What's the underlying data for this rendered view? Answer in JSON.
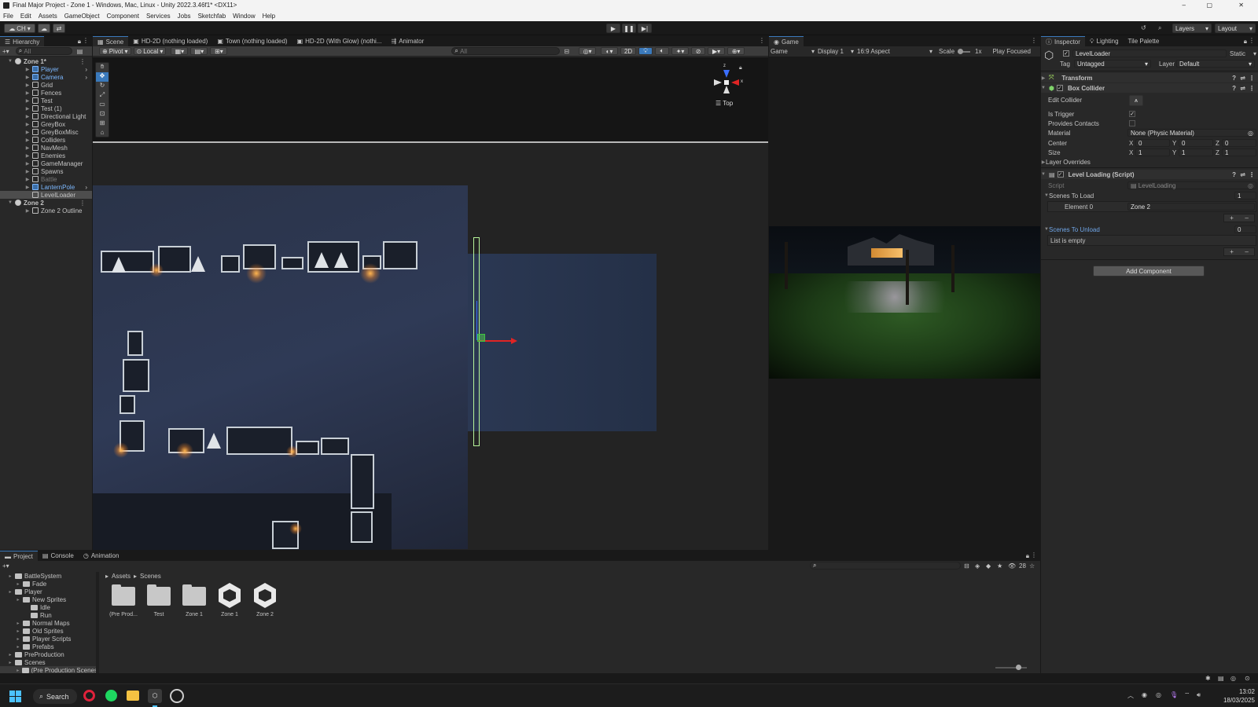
{
  "window": {
    "title": "Final Major Project - Zone 1 - Windows, Mac, Linux - Unity 2022.3.46f1* <DX11>",
    "min": "–",
    "max": "▢",
    "close": "✕"
  },
  "menu": [
    "File",
    "Edit",
    "Assets",
    "GameObject",
    "Component",
    "Services",
    "Jobs",
    "Sketchfab",
    "Window",
    "Help"
  ],
  "toolbar": {
    "account": "CH",
    "layers": "Layers",
    "layout": "Layout"
  },
  "hierarchy": {
    "tab": "Hierarchy",
    "search_placeholder": "All",
    "items": [
      {
        "label": "Zone 1*",
        "depth": 0,
        "type": "scene",
        "expanded": true
      },
      {
        "label": "Player",
        "depth": 1,
        "type": "prefab"
      },
      {
        "label": "Camera",
        "depth": 1,
        "type": "prefab"
      },
      {
        "label": "Grid",
        "depth": 1,
        "type": "obj"
      },
      {
        "label": "Fences",
        "depth": 1,
        "type": "obj"
      },
      {
        "label": "Test",
        "depth": 1,
        "type": "obj"
      },
      {
        "label": "Test (1)",
        "depth": 1,
        "type": "obj"
      },
      {
        "label": "Directional Light",
        "depth": 1,
        "type": "obj"
      },
      {
        "label": "GreyBox",
        "depth": 1,
        "type": "obj"
      },
      {
        "label": "GreyBoxMisc",
        "depth": 1,
        "type": "obj"
      },
      {
        "label": "Colliders",
        "depth": 1,
        "type": "obj"
      },
      {
        "label": "NavMesh",
        "depth": 1,
        "type": "obj"
      },
      {
        "label": "Enemies",
        "depth": 1,
        "type": "obj"
      },
      {
        "label": "GameManager",
        "depth": 1,
        "type": "obj"
      },
      {
        "label": "Spawns",
        "depth": 1,
        "type": "obj"
      },
      {
        "label": "Battle",
        "depth": 1,
        "type": "disabled"
      },
      {
        "label": "LanternPole",
        "depth": 1,
        "type": "prefab"
      },
      {
        "label": "LevelLoader",
        "depth": 1,
        "type": "selected"
      },
      {
        "label": "Zone 2",
        "depth": 0,
        "type": "scene",
        "expanded": true
      },
      {
        "label": "Zone 2 Outline",
        "depth": 1,
        "type": "obj"
      }
    ]
  },
  "scene_tabs": [
    {
      "label": "Scene",
      "active": true
    },
    {
      "label": "HD-2D (nothing loaded)"
    },
    {
      "label": "Town (nothing loaded)"
    },
    {
      "label": "HD-2D (With Glow) (nothi..."
    },
    {
      "label": "Animator"
    }
  ],
  "scene_toolbar": {
    "pivot": "Pivot",
    "local": "Local",
    "search_placeholder": "All",
    "mode_2d": "2D",
    "gizmo_view": "Top"
  },
  "game": {
    "tab": "Game",
    "display_mode": "Game",
    "display": "Display 1",
    "aspect": "16:9 Aspect",
    "scale_label": "Scale",
    "scale_value": "1x",
    "play_mode": "Play Focused"
  },
  "inspector": {
    "tabs": [
      "Inspector",
      "Lighting",
      "Tile Palette"
    ],
    "object_name": "LevelLoader",
    "static_label": "Static",
    "tag_label": "Tag",
    "tag_value": "Untagged",
    "layer_label": "Layer",
    "layer_value": "Default",
    "transform": "Transform",
    "box_collider": "Box Collider",
    "edit_collider": "Edit Collider",
    "is_trigger": "Is Trigger",
    "provides_contacts": "Provides Contacts",
    "material_label": "Material",
    "material_value": "None (Physic Material)",
    "center_label": "Center",
    "center": {
      "x": "0",
      "y": "0",
      "z": "0"
    },
    "size_label": "Size",
    "size": {
      "x": "1",
      "y": "1",
      "z": "1"
    },
    "layer_overrides": "Layer Overrides",
    "script_component": "Level Loading (Script)",
    "script_label": "Script",
    "script_value": "LevelLoading",
    "scenes_to_load": "Scenes To Load",
    "scenes_to_load_count": "1",
    "element0_label": "Element 0",
    "element0_value": "Zone 2",
    "scenes_to_unload": "Scenes To Unload",
    "scenes_to_unload_count": "0",
    "list_empty": "List is empty",
    "add_component": "Add Component",
    "axis_x": "X",
    "axis_y": "Y",
    "axis_z": "Z",
    "plus": "+",
    "minus": "–"
  },
  "project": {
    "tabs": [
      "Project",
      "Console",
      "Animation"
    ],
    "tree": [
      {
        "label": "BattleSystem",
        "depth": 0
      },
      {
        "label": "Fade",
        "depth": 1
      },
      {
        "label": "Player",
        "depth": 0
      },
      {
        "label": "New Sprites",
        "depth": 1
      },
      {
        "label": "Idle",
        "depth": 2
      },
      {
        "label": "Run",
        "depth": 2
      },
      {
        "label": "Normal Maps",
        "depth": 1
      },
      {
        "label": "Old Sprites",
        "depth": 1
      },
      {
        "label": "Player Scripts",
        "depth": 1
      },
      {
        "label": "Prefabs",
        "depth": 1
      },
      {
        "label": "PreProduction",
        "depth": 0
      },
      {
        "label": "Scenes",
        "depth": 0
      },
      {
        "label": "(Pre Production Scenes",
        "depth": 1
      }
    ],
    "breadcrumb": [
      "Assets",
      "Scenes"
    ],
    "hidden_count": "28",
    "assets": [
      {
        "label": "(Pre Prod...",
        "kind": "folder"
      },
      {
        "label": "Test",
        "kind": "folder"
      },
      {
        "label": "Zone 1",
        "kind": "folder"
      },
      {
        "label": "Zone 1",
        "kind": "scene"
      },
      {
        "label": "Zone 2",
        "kind": "scene"
      }
    ]
  },
  "taskbar": {
    "search": "Search",
    "time": "13:02",
    "date": "18/03/2025"
  }
}
